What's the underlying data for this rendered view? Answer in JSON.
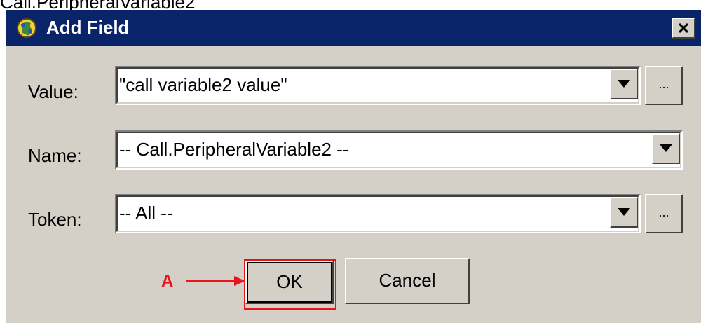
{
  "caption": "Call.PeripheralVariable2",
  "dialog": {
    "title": "Add Field",
    "close_glyph": "✕"
  },
  "fields": {
    "value": {
      "label": "Value:",
      "text": "\"call variable2 value\"",
      "browse_label": "..."
    },
    "name": {
      "label": "Name:",
      "text": "-- Call.PeripheralVariable2 --"
    },
    "token": {
      "label": "Token:",
      "text": "-- All --",
      "browse_label": "..."
    }
  },
  "buttons": {
    "ok_label": "OK",
    "cancel_label": "Cancel"
  },
  "annotation": {
    "letter": "A"
  },
  "colors": {
    "dialog_bg": "#d4d0c8",
    "titlebar": "#0a246a",
    "annotation_red": "#e8141c"
  },
  "icons": {
    "app": "globe-app-icon",
    "close": "close-icon",
    "dropdown": "chevron-down-icon"
  }
}
